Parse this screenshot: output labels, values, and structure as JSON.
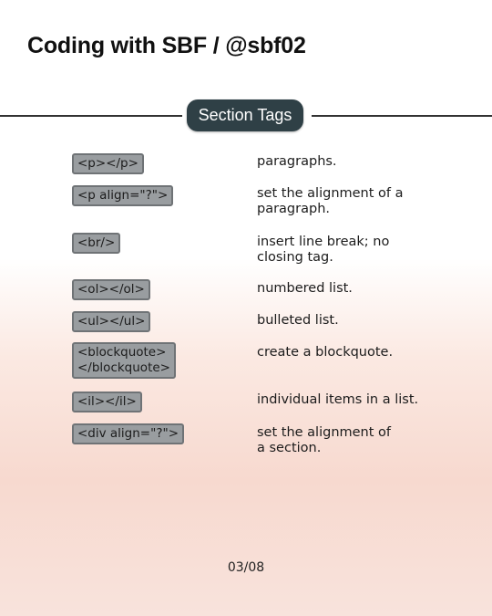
{
  "header": {
    "title": "Coding with SBF / @sbf02"
  },
  "section": {
    "title": "Section Tags"
  },
  "rows": [
    {
      "tag": "<p></p>",
      "desc": "paragraphs."
    },
    {
      "tag": "<p align=\"?\">",
      "desc": "set the alignment of a\nparagraph."
    },
    {
      "tag": "<br/>",
      "desc": "insert line break; no\nclosing tag."
    },
    {
      "tag": "<ol></ol>",
      "desc": "numbered list."
    },
    {
      "tag": "<ul></ul>",
      "desc": "bulleted list."
    },
    {
      "tag": "<blockquote>\n</blockquote>",
      "desc": "create a blockquote."
    },
    {
      "tag": "<il></il>",
      "desc": "individual items in a list."
    },
    {
      "tag": "<div align=\"?\">",
      "desc": "set the alignment of\na section."
    }
  ],
  "footer": {
    "page": "03/08"
  }
}
